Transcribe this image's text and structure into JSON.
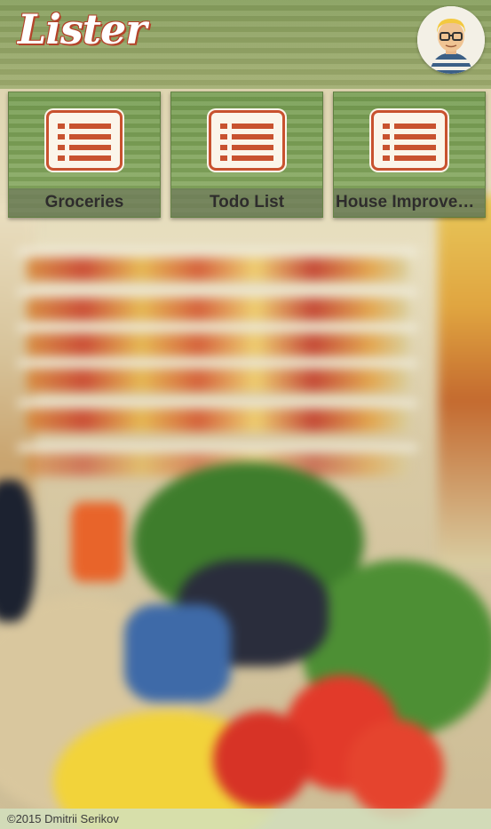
{
  "app": {
    "title": "Lister"
  },
  "header": {
    "logo_text": "Lister",
    "avatar_icon": "user-avatar-icon"
  },
  "lists": [
    {
      "label": "Groceries",
      "icon": "list-icon"
    },
    {
      "label": "Todo List",
      "icon": "list-icon"
    },
    {
      "label": "House Improveme..",
      "icon": "list-icon"
    }
  ],
  "footer": {
    "copyright": "©2015 Dmitrii Serikov"
  },
  "colors": {
    "accent": "#c8522f",
    "tile_bg": "#78a050",
    "header_bg": "#8ca05a"
  }
}
